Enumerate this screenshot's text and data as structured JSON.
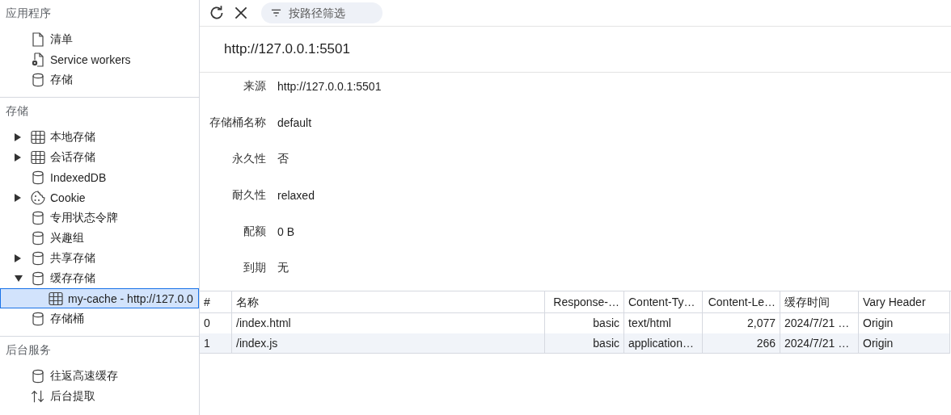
{
  "sidebar": {
    "sections": [
      {
        "title": "应用程序",
        "items": [
          {
            "label": "清单",
            "kind": "file",
            "selected": false
          },
          {
            "label": "Service workers",
            "kind": "gear-file",
            "selected": false
          },
          {
            "label": "存储",
            "kind": "db",
            "selected": false
          }
        ]
      },
      {
        "title": "存储",
        "items": [
          {
            "label": "本地存储",
            "kind": "table",
            "selected": false,
            "expanded": false
          },
          {
            "label": "会话存储",
            "kind": "table",
            "selected": false,
            "expanded": false
          },
          {
            "label": "IndexedDB",
            "kind": "db",
            "selected": false
          },
          {
            "label": "Cookie",
            "kind": "cookie",
            "selected": false,
            "expanded": false
          },
          {
            "label": "专用状态令牌",
            "kind": "db",
            "selected": false
          },
          {
            "label": "兴趣组",
            "kind": "db",
            "selected": false
          },
          {
            "label": "共享存储",
            "kind": "db",
            "selected": false,
            "expanded": false
          },
          {
            "label": "缓存存储",
            "kind": "db",
            "selected": false,
            "expanded": true,
            "children": [
              {
                "label": "my-cache - http://127.0.0",
                "kind": "table",
                "selected": true
              }
            ]
          },
          {
            "label": "存储桶",
            "kind": "db",
            "selected": false
          }
        ]
      },
      {
        "title": "后台服务",
        "items": [
          {
            "label": "往返高速缓存",
            "kind": "db",
            "selected": false
          },
          {
            "label": "后台提取",
            "kind": "arrows",
            "selected": false
          }
        ]
      }
    ]
  },
  "toolbar": {
    "filter": {
      "placeholder": "按路径筛选"
    }
  },
  "cache": {
    "title": "http://127.0.0.1:5501",
    "properties": [
      {
        "label": "来源",
        "value": "http://127.0.0.1:5501"
      },
      {
        "label": "存储桶名称",
        "value": "default"
      },
      {
        "label": "永久性",
        "value": "否"
      },
      {
        "label": "耐久性",
        "value": "relaxed"
      },
      {
        "label": "配额",
        "value": "0 B"
      },
      {
        "label": "到期",
        "value": "无"
      }
    ]
  },
  "table": {
    "columns": [
      {
        "label": "#"
      },
      {
        "label": "名称"
      },
      {
        "label": "Response-…"
      },
      {
        "label": "Content-Ty…"
      },
      {
        "label": "Content-Le…"
      },
      {
        "label": "缓存时间"
      },
      {
        "label": "Vary Header"
      }
    ],
    "rows": [
      [
        "0",
        "/index.html",
        "basic",
        "text/html",
        "2,077",
        "2024/7/21 …",
        "Origin"
      ],
      [
        "1",
        "/index.js",
        "basic",
        "application…",
        "266",
        "2024/7/21 …",
        "Origin"
      ]
    ]
  }
}
